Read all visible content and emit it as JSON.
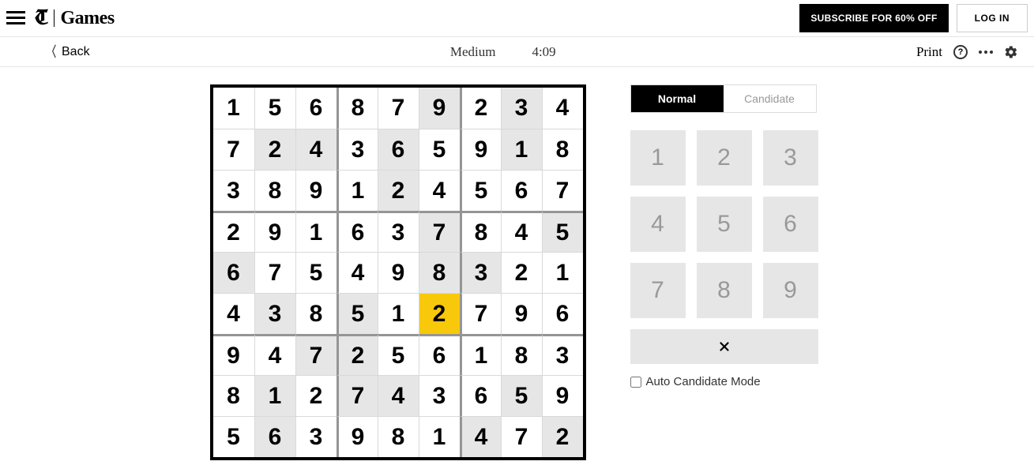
{
  "nav": {
    "logo_t": "T",
    "logo_games": "Games",
    "subscribe": "SUBSCRIBE FOR 60% OFF",
    "login": "LOG IN"
  },
  "secbar": {
    "back": "Back",
    "difficulty": "Medium",
    "timer": "4:09",
    "print": "Print"
  },
  "board": {
    "cells": [
      [
        {
          "v": "1",
          "g": false
        },
        {
          "v": "5",
          "g": false
        },
        {
          "v": "6",
          "g": false
        },
        {
          "v": "8",
          "g": false
        },
        {
          "v": "7",
          "g": false
        },
        {
          "v": "9",
          "g": true
        },
        {
          "v": "2",
          "g": false
        },
        {
          "v": "3",
          "g": true
        },
        {
          "v": "4",
          "g": false
        }
      ],
      [
        {
          "v": "7",
          "g": false
        },
        {
          "v": "2",
          "g": true
        },
        {
          "v": "4",
          "g": true
        },
        {
          "v": "3",
          "g": false
        },
        {
          "v": "6",
          "g": true
        },
        {
          "v": "5",
          "g": false
        },
        {
          "v": "9",
          "g": false
        },
        {
          "v": "1",
          "g": true
        },
        {
          "v": "8",
          "g": false
        }
      ],
      [
        {
          "v": "3",
          "g": false
        },
        {
          "v": "8",
          "g": false
        },
        {
          "v": "9",
          "g": false
        },
        {
          "v": "1",
          "g": false
        },
        {
          "v": "2",
          "g": true
        },
        {
          "v": "4",
          "g": false
        },
        {
          "v": "5",
          "g": false
        },
        {
          "v": "6",
          "g": false
        },
        {
          "v": "7",
          "g": false
        }
      ],
      [
        {
          "v": "2",
          "g": false
        },
        {
          "v": "9",
          "g": false
        },
        {
          "v": "1",
          "g": false
        },
        {
          "v": "6",
          "g": false
        },
        {
          "v": "3",
          "g": false
        },
        {
          "v": "7",
          "g": true
        },
        {
          "v": "8",
          "g": false
        },
        {
          "v": "4",
          "g": false
        },
        {
          "v": "5",
          "g": true
        }
      ],
      [
        {
          "v": "6",
          "g": true
        },
        {
          "v": "7",
          "g": false
        },
        {
          "v": "5",
          "g": false
        },
        {
          "v": "4",
          "g": false
        },
        {
          "v": "9",
          "g": false
        },
        {
          "v": "8",
          "g": true
        },
        {
          "v": "3",
          "g": true
        },
        {
          "v": "2",
          "g": false
        },
        {
          "v": "1",
          "g": false
        }
      ],
      [
        {
          "v": "4",
          "g": false
        },
        {
          "v": "3",
          "g": true
        },
        {
          "v": "8",
          "g": false
        },
        {
          "v": "5",
          "g": true
        },
        {
          "v": "1",
          "g": false
        },
        {
          "v": "2",
          "g": false,
          "sel": true
        },
        {
          "v": "7",
          "g": false
        },
        {
          "v": "9",
          "g": false
        },
        {
          "v": "6",
          "g": false
        }
      ],
      [
        {
          "v": "9",
          "g": false
        },
        {
          "v": "4",
          "g": false
        },
        {
          "v": "7",
          "g": true
        },
        {
          "v": "2",
          "g": true
        },
        {
          "v": "5",
          "g": false
        },
        {
          "v": "6",
          "g": false
        },
        {
          "v": "1",
          "g": false
        },
        {
          "v": "8",
          "g": false
        },
        {
          "v": "3",
          "g": false
        }
      ],
      [
        {
          "v": "8",
          "g": false
        },
        {
          "v": "1",
          "g": true
        },
        {
          "v": "2",
          "g": false
        },
        {
          "v": "7",
          "g": true
        },
        {
          "v": "4",
          "g": true
        },
        {
          "v": "3",
          "g": false
        },
        {
          "v": "6",
          "g": false
        },
        {
          "v": "5",
          "g": true
        },
        {
          "v": "9",
          "g": false
        }
      ],
      [
        {
          "v": "5",
          "g": false
        },
        {
          "v": "6",
          "g": true
        },
        {
          "v": "3",
          "g": false
        },
        {
          "v": "9",
          "g": false
        },
        {
          "v": "8",
          "g": false
        },
        {
          "v": "1",
          "g": false
        },
        {
          "v": "4",
          "g": true
        },
        {
          "v": "7",
          "g": false
        },
        {
          "v": "2",
          "g": true
        }
      ]
    ]
  },
  "panel": {
    "tab_normal": "Normal",
    "tab_candidate": "Candidate",
    "keys": [
      "1",
      "2",
      "3",
      "4",
      "5",
      "6",
      "7",
      "8",
      "9"
    ],
    "auto_label": "Auto Candidate Mode"
  }
}
